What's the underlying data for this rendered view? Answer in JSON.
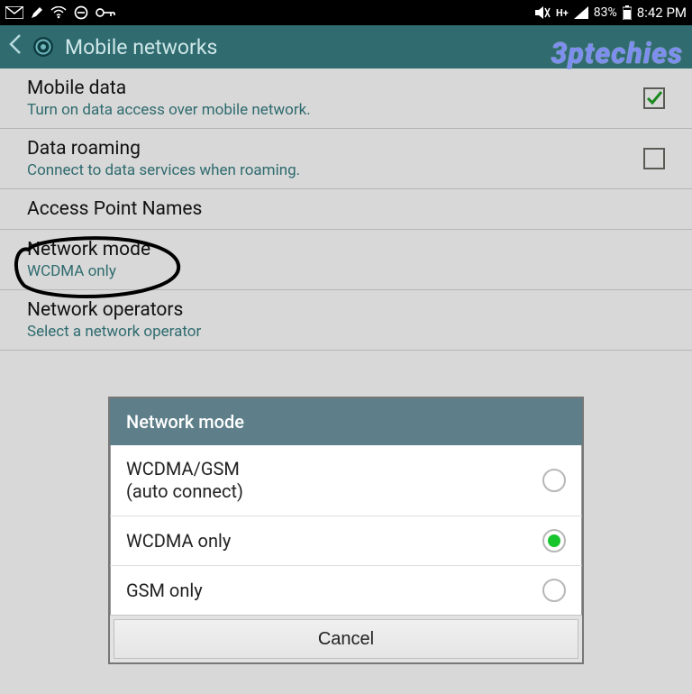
{
  "status": {
    "battery_pct": "83%",
    "time": "8:42 PM",
    "netmode": "H+"
  },
  "header": {
    "title": "Mobile networks"
  },
  "watermark": "3ptechies",
  "settings": [
    {
      "title": "Mobile data",
      "sub": "Turn on data access over mobile network.",
      "checkbox": true,
      "checked": true
    },
    {
      "title": "Data roaming",
      "sub": "Connect to data services when roaming.",
      "checkbox": true,
      "checked": false
    },
    {
      "title": "Access Point Names",
      "sub": "",
      "checkbox": false
    },
    {
      "title": "Network mode",
      "sub": "WCDMA only",
      "checkbox": false
    },
    {
      "title": "Network operators",
      "sub": "Select a network operator",
      "checkbox": false
    }
  ],
  "dialog": {
    "title": "Network mode",
    "options": [
      {
        "label": "WCDMA/GSM\n(auto connect)",
        "selected": false
      },
      {
        "label": "WCDMA only",
        "selected": true
      },
      {
        "label": "GSM only",
        "selected": false
      }
    ],
    "cancel": "Cancel"
  }
}
